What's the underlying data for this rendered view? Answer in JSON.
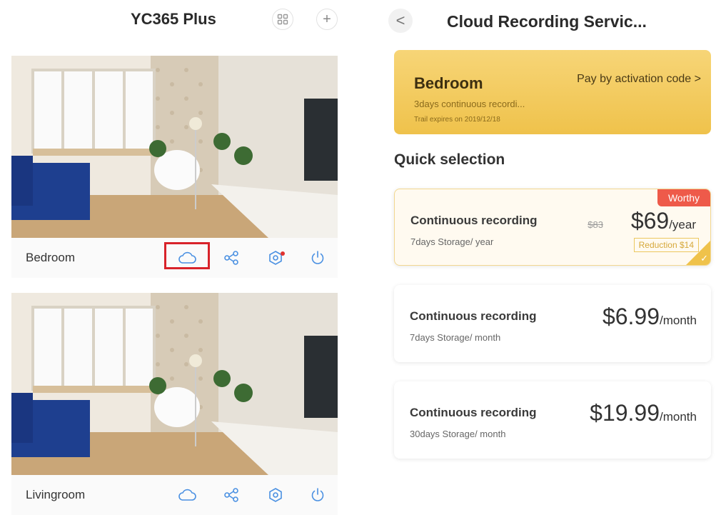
{
  "left_screen": {
    "app_title": "YC365 Plus",
    "header_icons": [
      "grid-icon",
      "plus-icon"
    ],
    "plus_glyph": "+",
    "cameras": [
      {
        "name": "Bedroom",
        "actions": [
          "cloud-icon",
          "share-icon",
          "settings-icon",
          "power-icon"
        ],
        "highlighted_action": "cloud-icon",
        "settings_notification": true
      },
      {
        "name": "Livingroom",
        "actions": [
          "cloud-icon",
          "share-icon",
          "settings-icon",
          "power-icon"
        ]
      }
    ]
  },
  "right_screen": {
    "back_glyph": "<",
    "page_title": "Cloud Recording Servic...",
    "device_card": {
      "device_name": "Bedroom",
      "activation_link": "Pay by activation code >",
      "subtitle": "3days continuous recordi...",
      "trail_text": "Trail expires on 2019/12/18"
    },
    "section_title": "Quick selection",
    "plans": [
      {
        "name": "Continuous recording",
        "storage": "7days Storage/ year",
        "old_price": "$83",
        "price": "$69",
        "unit": "/year",
        "badge": "Worthy",
        "reduction": "Reduction $14",
        "selected": true
      },
      {
        "name": "Continuous recording",
        "storage": "7days Storage/ month",
        "price": "$6.99",
        "unit": "/month",
        "selected": false
      },
      {
        "name": "Continuous recording",
        "storage": "30days Storage/ month",
        "price": "$19.99",
        "unit": "/month",
        "selected": false
      }
    ]
  },
  "colors": {
    "accent_gold": "#efc24b",
    "highlight_red": "#d8232a",
    "badge_red": "#ee5a4a",
    "icon_blue": "#4a90e2"
  }
}
